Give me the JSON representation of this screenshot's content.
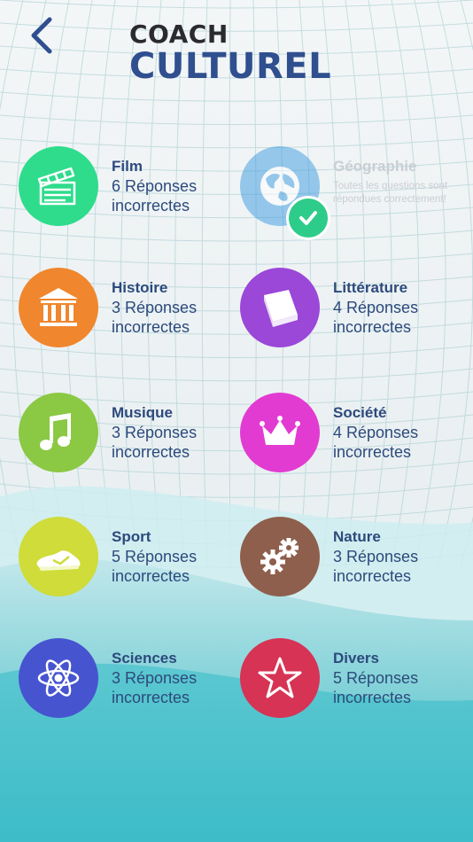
{
  "header": {
    "title_line1": "COACH",
    "title_line2": "CULTUREL"
  },
  "colors": {
    "film": "#2edc8c",
    "geographie": "#3a9be0",
    "histoire": "#f0862e",
    "litterature": "#9b47d8",
    "musique": "#8bc843",
    "societe": "#e23bd2",
    "sport": "#cfdc3a",
    "nature": "#8e5f4c",
    "sciences": "#4654d0",
    "divers": "#d63355",
    "check": "#2ecc8a",
    "text": "#2c4a7c"
  },
  "categories": [
    {
      "name": "Film",
      "status_line1": "6 Réponses",
      "status_line2": "incorrectes",
      "icon": "clapperboard-icon"
    },
    {
      "name": "Géographie",
      "status_line1": "Toutes les questions sont",
      "status_line2": "répondues correctement!",
      "icon": "globe-icon",
      "completed": true
    },
    {
      "name": "Histoire",
      "status_line1": "3 Réponses",
      "status_line2": "incorrectes",
      "icon": "museum-icon"
    },
    {
      "name": "Littérature",
      "status_line1": "4 Réponses",
      "status_line2": "incorrectes",
      "icon": "book-icon"
    },
    {
      "name": "Musique",
      "status_line1": "3 Réponses",
      "status_line2": "incorrectes",
      "icon": "music-note-icon"
    },
    {
      "name": "Société",
      "status_line1": "4 Réponses",
      "status_line2": "incorrectes",
      "icon": "crown-icon"
    },
    {
      "name": "Sport",
      "status_line1": "5 Réponses",
      "status_line2": "incorrectes",
      "icon": "sneaker-icon"
    },
    {
      "name": "Nature",
      "status_line1": "3 Réponses",
      "status_line2": "incorrectes",
      "icon": "gears-icon"
    },
    {
      "name": "Sciences",
      "status_line1": "3 Réponses",
      "status_line2": "incorrectes",
      "icon": "atom-icon"
    },
    {
      "name": "Divers",
      "status_line1": "5 Réponses",
      "status_line2": "incorrectes",
      "icon": "star-icon"
    }
  ]
}
